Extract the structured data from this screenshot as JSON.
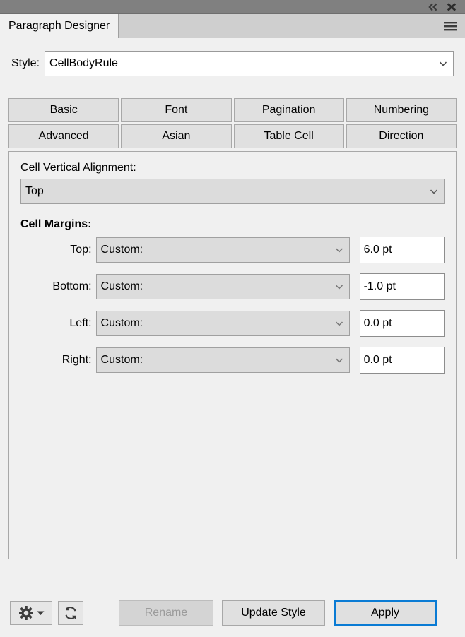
{
  "titlebar": {
    "collapse_icon": "double-chevron-left-icon",
    "close_icon": "close-icon",
    "collapse_glyph": "«",
    "close_glyph": "✖"
  },
  "tabbar": {
    "doc_tab_label": "Paragraph Designer",
    "menu_icon": "hamburger-menu-icon"
  },
  "style": {
    "label": "Style:",
    "value": "CellBodyRule"
  },
  "tabs": [
    {
      "label": "Basic"
    },
    {
      "label": "Font"
    },
    {
      "label": "Pagination"
    },
    {
      "label": "Numbering"
    },
    {
      "label": "Advanced"
    },
    {
      "label": "Asian"
    },
    {
      "label": "Table Cell"
    },
    {
      "label": "Direction"
    }
  ],
  "panel": {
    "vertical_alignment": {
      "label": "Cell Vertical Alignment:",
      "value": "Top"
    },
    "cell_margins": {
      "title": "Cell Margins:",
      "rows": [
        {
          "label": "Top:",
          "mode": "Custom:",
          "value": "6.0 pt"
        },
        {
          "label": "Bottom:",
          "mode": "Custom:",
          "value": "-1.0 pt"
        },
        {
          "label": "Left:",
          "mode": "Custom:",
          "value": "0.0 pt"
        },
        {
          "label": "Right:",
          "mode": "Custom:",
          "value": "0.0 pt"
        }
      ]
    }
  },
  "bottombar": {
    "settings_icon": "gear-icon",
    "settings_dropdown_icon": "caret-down-icon",
    "refresh_icon": "refresh-icon",
    "rename_label": "Rename",
    "update_style_label": "Update Style",
    "apply_label": "Apply"
  },
  "colors": {
    "focus_blue": "#0a7bd4",
    "titlebar_gray": "#808080",
    "panel_bg": "#f0f0f0",
    "control_gray": "#dcdcdc"
  }
}
